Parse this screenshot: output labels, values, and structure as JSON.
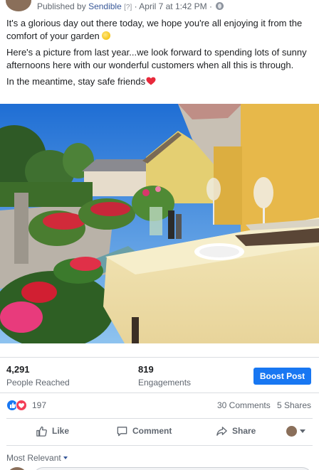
{
  "post": {
    "published_by_label": "Published by",
    "author": "Sendible",
    "author_flag": "[?]",
    "date": "April 7 at 1:42 PM",
    "paragraphs": [
      "It's a glorious day out there today, we hope you're all enjoying it from the comfort of your garden",
      "Here's a picture from last year...we look forward to spending lots of sunny afternoons here with our wonderful customers when all this is through.",
      "In the meantime, stay safe friends"
    ]
  },
  "insights": {
    "reach_value": "4,291",
    "reach_label": "People Reached",
    "engagement_value": "819",
    "engagement_label": "Engagements",
    "boost_label": "Boost Post"
  },
  "reactions": {
    "count": "197",
    "comments": "30 Comments",
    "shares": "5 Shares"
  },
  "actions": {
    "like": "Like",
    "comment": "Comment",
    "share": "Share"
  },
  "comments": {
    "sort_label": "Most Relevant"
  },
  "colors": {
    "link": "#385898",
    "accent": "#1877f2",
    "love": "#f33e58"
  }
}
